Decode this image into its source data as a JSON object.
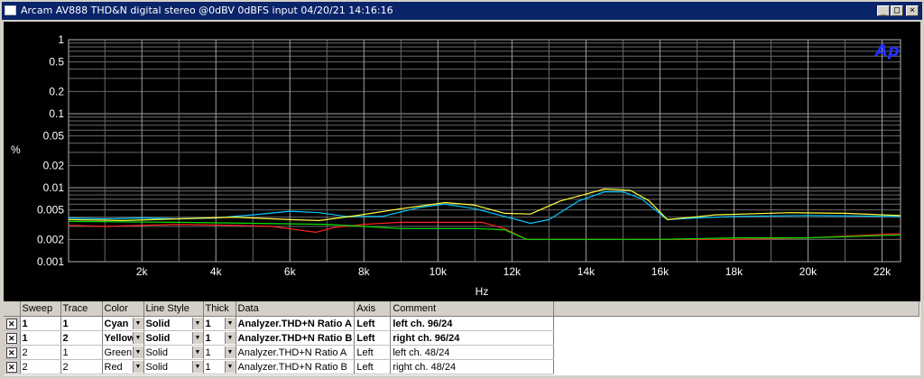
{
  "window": {
    "title": "Arcam AV888 THD&N digital stereo @0dBV 0dBFS input  04/20/21 14:16:16",
    "min_glyph": "_",
    "max_glyph": "□",
    "close_glyph": "×"
  },
  "chart_data": {
    "type": "line",
    "ylabel": "%",
    "xlabel": "Hz",
    "yscale": "log",
    "ylim": [
      0.001,
      1
    ],
    "xlim": [
      20,
      22500
    ],
    "y_ticks": [
      "1",
      "0.5",
      "0.2",
      "0.1",
      "0.05",
      "0.02",
      "0.01",
      "0.005",
      "0.002",
      "0.001"
    ],
    "y_tick_values": [
      1,
      0.5,
      0.2,
      0.1,
      0.05,
      0.02,
      0.01,
      0.005,
      0.002,
      0.001
    ],
    "x_ticks": [
      "2k",
      "4k",
      "6k",
      "8k",
      "10k",
      "12k",
      "14k",
      "16k",
      "18k",
      "20k",
      "22k"
    ],
    "x_tick_values": [
      2000,
      4000,
      6000,
      8000,
      10000,
      12000,
      14000,
      16000,
      18000,
      20000,
      22000
    ],
    "grid": true,
    "background": "#000000",
    "logo": "Ap",
    "series": [
      {
        "name": "Cyan",
        "color": "#00c8ff",
        "points": [
          [
            20,
            0.0039
          ],
          [
            1000,
            0.0038
          ],
          [
            2000,
            0.0039
          ],
          [
            3000,
            0.0038
          ],
          [
            4000,
            0.0039
          ],
          [
            5000,
            0.0043
          ],
          [
            6000,
            0.0048
          ],
          [
            6800,
            0.0046
          ],
          [
            7500,
            0.0041
          ],
          [
            8500,
            0.0041
          ],
          [
            9500,
            0.0054
          ],
          [
            10200,
            0.006
          ],
          [
            11000,
            0.0052
          ],
          [
            11800,
            0.0041
          ],
          [
            12500,
            0.0033
          ],
          [
            13000,
            0.0037
          ],
          [
            13800,
            0.0066
          ],
          [
            14500,
            0.0088
          ],
          [
            15000,
            0.0088
          ],
          [
            15500,
            0.0071
          ],
          [
            16200,
            0.0037
          ],
          [
            17000,
            0.0039
          ],
          [
            18000,
            0.0041
          ],
          [
            20000,
            0.0042
          ],
          [
            22500,
            0.0041
          ]
        ]
      },
      {
        "name": "Yellow",
        "color": "#ffff40",
        "points": [
          [
            20,
            0.0037
          ],
          [
            1500,
            0.0036
          ],
          [
            3000,
            0.0038
          ],
          [
            4500,
            0.004
          ],
          [
            6000,
            0.0037
          ],
          [
            6800,
            0.0036
          ],
          [
            7800,
            0.0042
          ],
          [
            9000,
            0.0052
          ],
          [
            10200,
            0.0063
          ],
          [
            11000,
            0.0058
          ],
          [
            11800,
            0.0045
          ],
          [
            12500,
            0.0044
          ],
          [
            13300,
            0.0066
          ],
          [
            14500,
            0.0096
          ],
          [
            15200,
            0.0092
          ],
          [
            15700,
            0.0067
          ],
          [
            16200,
            0.0037
          ],
          [
            17500,
            0.0043
          ],
          [
            19500,
            0.0046
          ],
          [
            21000,
            0.0045
          ],
          [
            22500,
            0.0042
          ]
        ]
      },
      {
        "name": "Green",
        "color": "#00e000",
        "points": [
          [
            20,
            0.0035
          ],
          [
            3000,
            0.0034
          ],
          [
            5000,
            0.0033
          ],
          [
            7000,
            0.0032
          ],
          [
            8000,
            0.003
          ],
          [
            9000,
            0.0028
          ],
          [
            11000,
            0.0028
          ],
          [
            11800,
            0.0027
          ],
          [
            12400,
            0.002
          ],
          [
            14000,
            0.002
          ],
          [
            16000,
            0.002
          ],
          [
            18000,
            0.0021
          ],
          [
            20000,
            0.0021
          ],
          [
            22500,
            0.0023
          ]
        ]
      },
      {
        "name": "Red",
        "color": "#ff2020",
        "points": [
          [
            20,
            0.0031
          ],
          [
            1000,
            0.003
          ],
          [
            3000,
            0.0032
          ],
          [
            4500,
            0.0031
          ],
          [
            5500,
            0.003
          ],
          [
            6700,
            0.0025
          ],
          [
            7200,
            0.0029
          ],
          [
            8000,
            0.0032
          ],
          [
            9000,
            0.0034
          ],
          [
            10000,
            0.0034
          ],
          [
            11200,
            0.0034
          ],
          [
            11800,
            0.0028
          ],
          [
            12400,
            0.002
          ],
          [
            14000,
            0.002
          ],
          [
            16000,
            0.002
          ],
          [
            18000,
            0.002
          ],
          [
            20000,
            0.0021
          ],
          [
            22500,
            0.0024
          ]
        ]
      }
    ]
  },
  "grid": {
    "headers": [
      "Sweep",
      "Trace",
      "Color",
      "Line Style",
      "Thick",
      "Data",
      "Axis",
      "Comment"
    ],
    "rows": [
      {
        "checked": "✕",
        "sweep": "1",
        "trace": "1",
        "color": "Cyan",
        "style": "Solid",
        "thick": "1",
        "data": "Analyzer.THD+N Ratio A",
        "axis": "Left",
        "comment": "left ch. 96/24",
        "bold": true
      },
      {
        "checked": "✕",
        "sweep": "1",
        "trace": "2",
        "color": "Yellow",
        "style": "Solid",
        "thick": "1",
        "data": "Analyzer.THD+N Ratio B",
        "axis": "Left",
        "comment": "right ch. 96/24",
        "bold": true
      },
      {
        "checked": "✕",
        "sweep": "2",
        "trace": "1",
        "color": "Green",
        "style": "Solid",
        "thick": "1",
        "data": "Analyzer.THD+N Ratio A",
        "axis": "Left",
        "comment": "left ch. 48/24",
        "bold": false
      },
      {
        "checked": "✕",
        "sweep": "2",
        "trace": "2",
        "color": "Red",
        "style": "Solid",
        "thick": "1",
        "data": "Analyzer.THD+N Ratio B",
        "axis": "Left",
        "comment": "right ch. 48/24",
        "bold": false
      }
    ]
  }
}
